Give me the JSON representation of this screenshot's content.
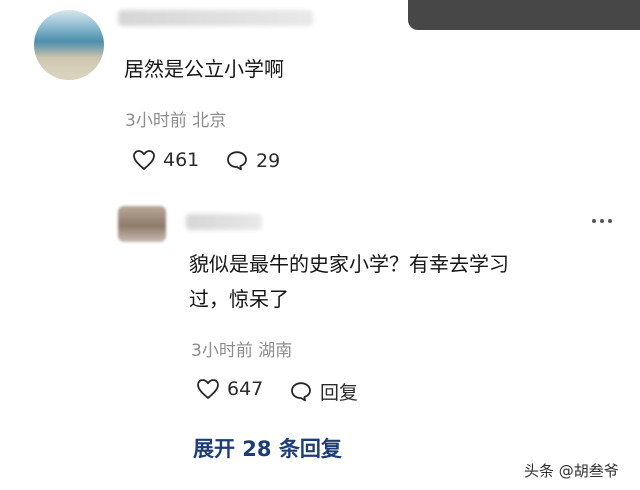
{
  "top_comment": {
    "text": "居然是公立小学啊",
    "meta": "3小时前 北京",
    "likes": "461",
    "replies": "29"
  },
  "reply_comment": {
    "text_line1": "貌似是最牛的史家小学？有幸去学习",
    "text_line2": "过，惊呆了",
    "meta": "3小时前 湖南",
    "likes": "647",
    "reply_label": "回复"
  },
  "expand_replies": "展开 28 条回复",
  "watermark": "头条 @胡叁爷",
  "icons": {
    "like": "heart-outline-icon",
    "comment": "speech-bubble-icon",
    "more": "more-options-icon"
  },
  "colors": {
    "text": "#151515",
    "meta": "#8d8d8d",
    "link": "#1d3d75"
  }
}
